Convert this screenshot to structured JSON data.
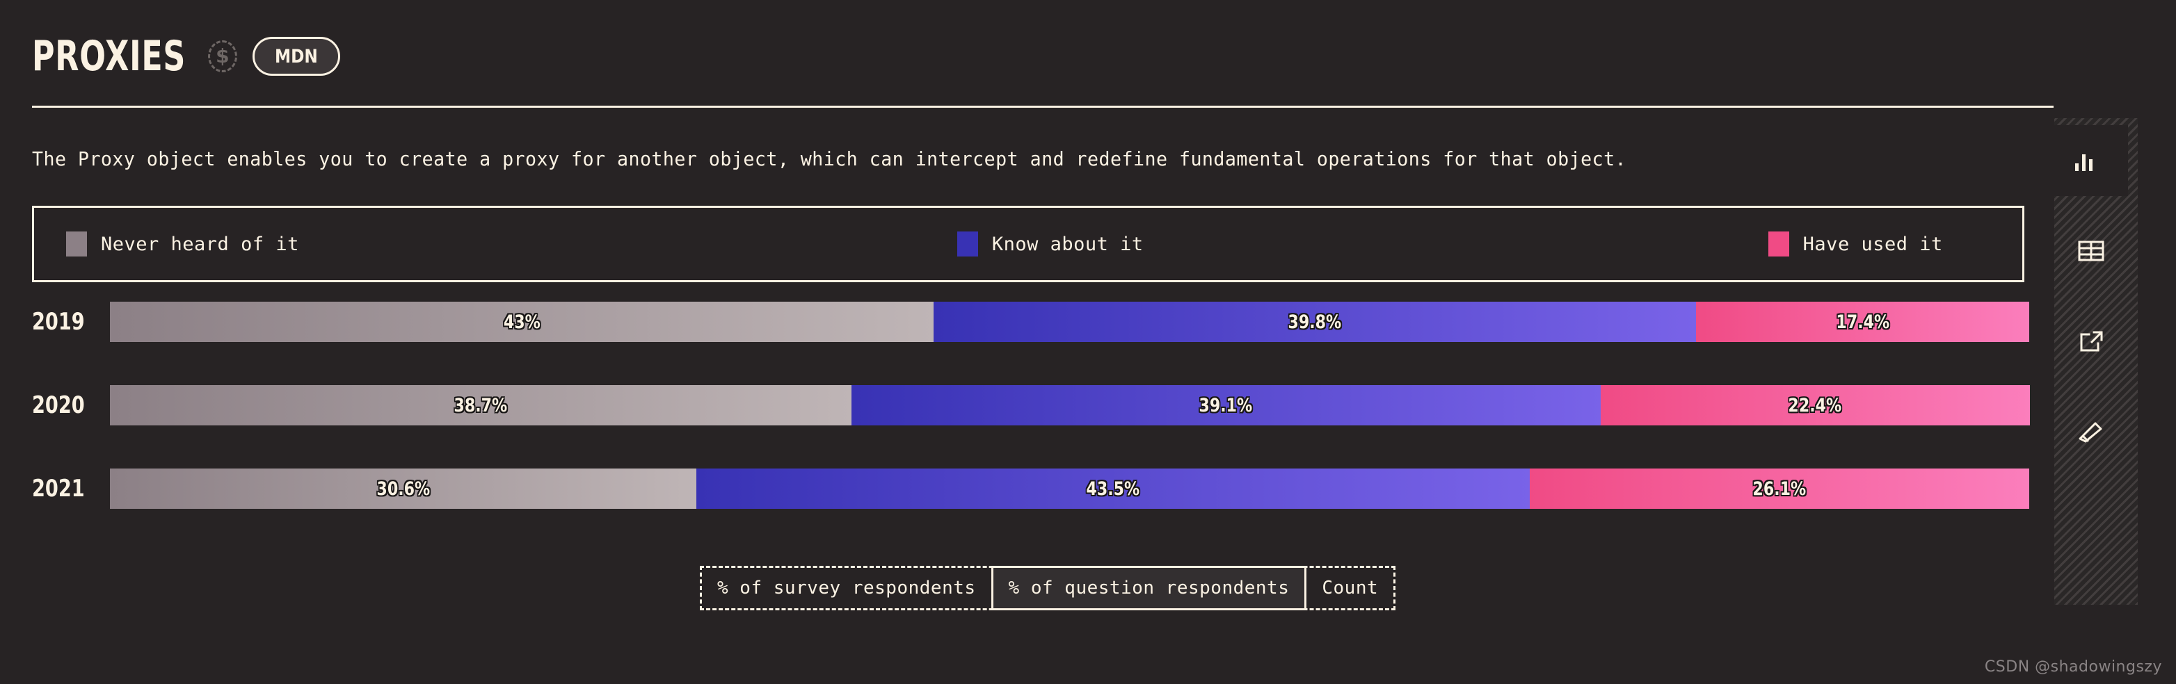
{
  "header": {
    "title": "PROXIES",
    "dollar_icon": "dollar-circle-dashed-icon",
    "mdn_label": "MDN"
  },
  "description": "The Proxy object enables you to create a proxy for another object, which can intercept and redefine fundamental operations for that object.",
  "legend": {
    "items": [
      {
        "label": "Never heard of it",
        "color": "#8C8086"
      },
      {
        "label": "Know about it",
        "color": "#3832B4"
      },
      {
        "label": "Have used it",
        "color": "#F04B85"
      }
    ]
  },
  "chart_data": {
    "type": "bar",
    "orientation": "horizontal",
    "stacked": true,
    "normalized_percent": true,
    "title": "PROXIES",
    "xlabel": "",
    "ylabel": "",
    "xlim": [
      0,
      100
    ],
    "grid": false,
    "legend_position": "top",
    "categories": [
      "2019",
      "2020",
      "2021"
    ],
    "series": [
      {
        "name": "Never heard of it",
        "color": "#8C8086",
        "values": [
          43,
          38.7,
          30.6
        ],
        "labels": [
          "43%",
          "38.7%",
          "30.6%"
        ]
      },
      {
        "name": "Know about it",
        "color": "#3832B4",
        "values": [
          39.8,
          39.1,
          43.5
        ],
        "labels": [
          "39.8%",
          "39.1%",
          "43.5%"
        ]
      },
      {
        "name": "Have used it",
        "color": "#F04B85",
        "values": [
          17.4,
          22.4,
          26.1
        ],
        "labels": [
          "17.4%",
          "22.4%",
          "26.1%"
        ]
      }
    ],
    "rows": [
      {
        "year": "2019",
        "segments": [
          {
            "series": "Never heard of it",
            "value": 43,
            "label": "43%"
          },
          {
            "series": "Know about it",
            "value": 39.8,
            "label": "39.8%"
          },
          {
            "series": "Have used it",
            "value": 17.4,
            "label": "17.4%"
          }
        ]
      },
      {
        "year": "2020",
        "segments": [
          {
            "series": "Never heard of it",
            "value": 38.7,
            "label": "38.7%"
          },
          {
            "series": "Know about it",
            "value": 39.1,
            "label": "39.1%"
          },
          {
            "series": "Have used it",
            "value": 22.4,
            "label": "22.4%"
          }
        ]
      },
      {
        "year": "2021",
        "segments": [
          {
            "series": "Never heard of it",
            "value": 30.6,
            "label": "30.6%"
          },
          {
            "series": "Know about it",
            "value": 43.5,
            "label": "43.5%"
          },
          {
            "series": "Have used it",
            "value": 26.1,
            "label": "26.1%"
          }
        ]
      }
    ]
  },
  "toggles": {
    "options": [
      {
        "label": "% of survey respondents",
        "selected": false
      },
      {
        "label": "% of question respondents",
        "selected": true
      },
      {
        "label": "Count",
        "selected": false
      }
    ]
  },
  "sidebar": {
    "items": [
      {
        "icon": "bar-chart-icon",
        "active": true
      },
      {
        "icon": "table-icon",
        "active": false
      },
      {
        "icon": "external-link-icon",
        "active": false
      },
      {
        "icon": "pencil-icon",
        "active": false
      }
    ]
  },
  "watermark": "CSDN @shadowingszy",
  "colors": {
    "background": "#272324",
    "foreground": "#FBF2E3",
    "never_heard": "#8C8086",
    "know_about": "#3832B4",
    "have_used": "#F04B85"
  }
}
